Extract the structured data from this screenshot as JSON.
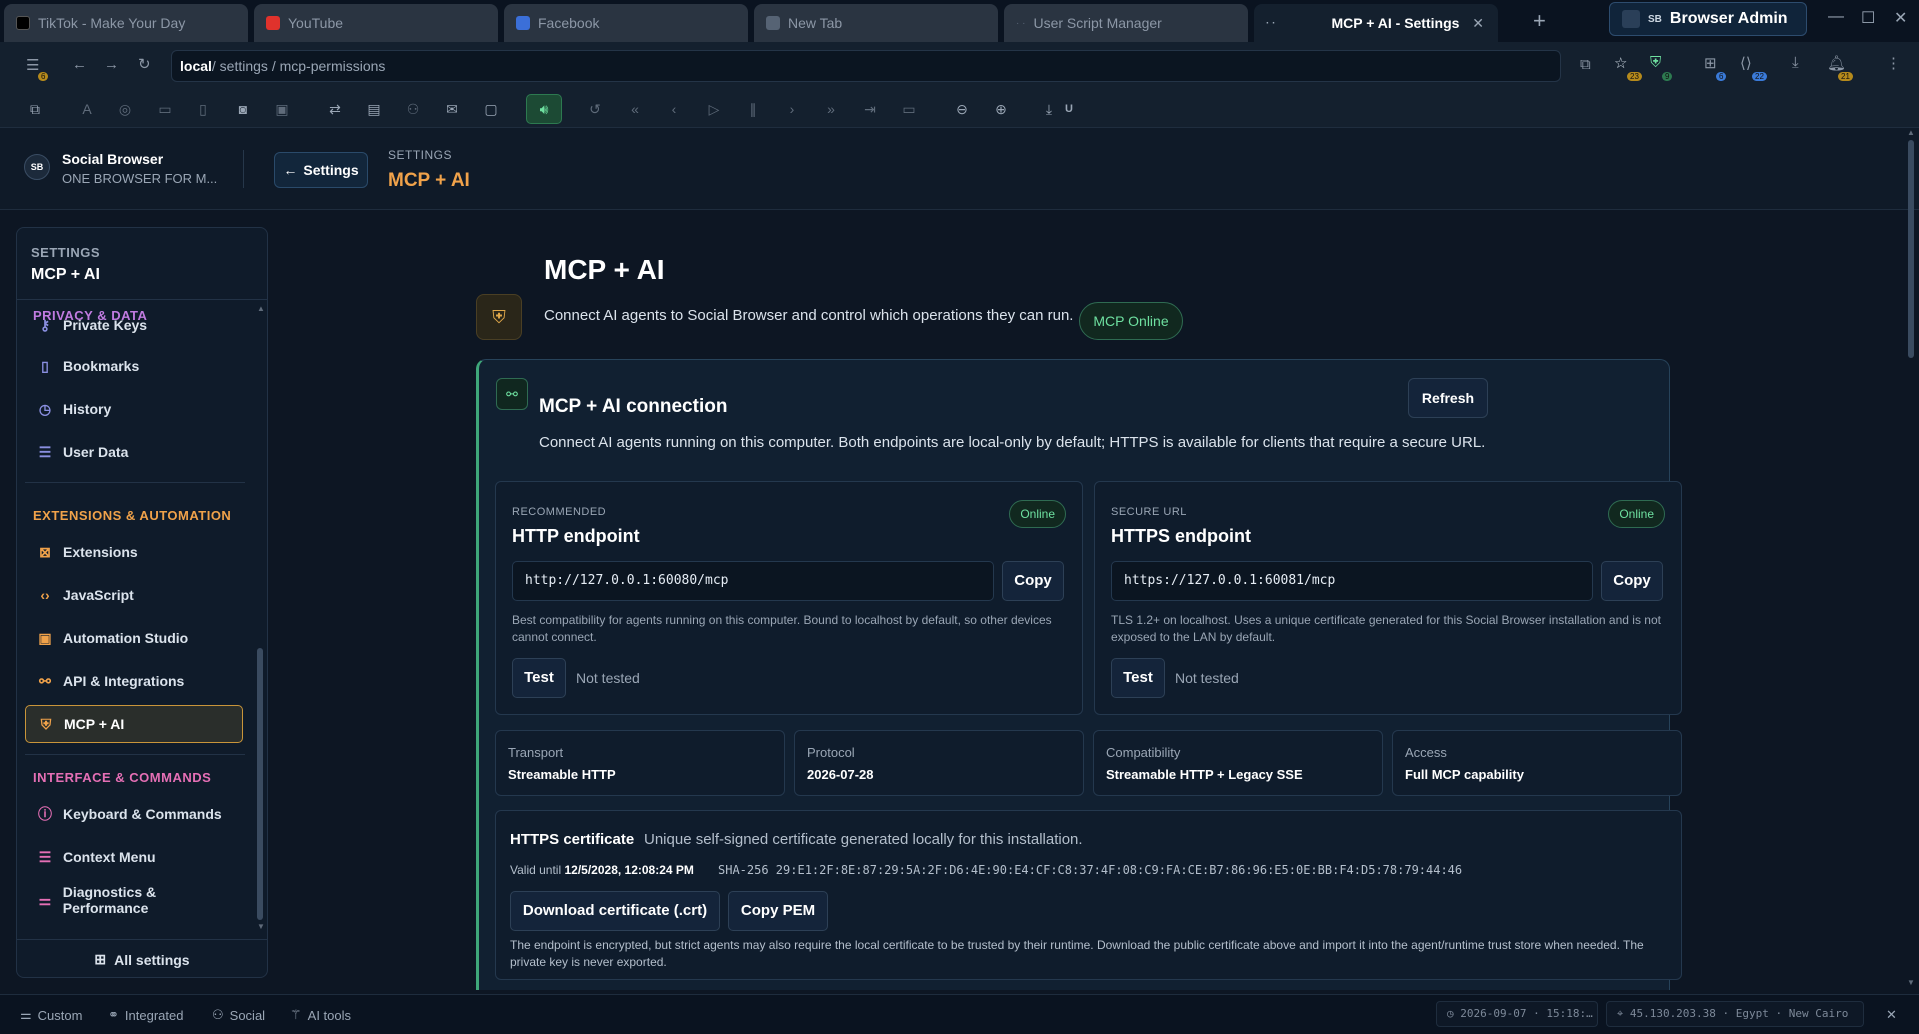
{
  "tabs": [
    {
      "label": "TikTok - Make Your Day",
      "icon": "tiktok-icon",
      "color": "#000000"
    },
    {
      "label": "YouTube",
      "icon": "youtube-icon",
      "color": "#e0322c"
    },
    {
      "label": "Facebook",
      "icon": "facebook-icon",
      "color": "#3b6fd8"
    },
    {
      "label": "New Tab",
      "icon": "shield-tab-icon",
      "color": "#566374"
    },
    {
      "label": "User Script Manager",
      "icon": "dots-tab-icon",
      "color": "#566374"
    },
    {
      "label": "MCP + AI - Settings",
      "icon": "dots-tab-icon",
      "color": "#566374",
      "active": true
    }
  ],
  "window": {
    "admin_prefix": "SB",
    "admin_label": "Browser Admin"
  },
  "address": {
    "host": "local",
    "path": " / settings / mcp-permissions"
  },
  "addr_badges": {
    "sidebar": "6",
    "star": "23",
    "shield": "9",
    "extensions": "6",
    "code": "22",
    "bell": "21"
  },
  "toolbar": {
    "download_label": "U"
  },
  "app": {
    "name": "Social Browser",
    "tagline": "ONE BROWSER FOR M...",
    "back_label": "Settings",
    "crumb_section": "SETTINGS",
    "crumb_page": "MCP + AI"
  },
  "sidebar": {
    "section_label": "SETTINGS",
    "title": "MCP + AI",
    "groups": [
      {
        "label": "PRIVACY & DATA",
        "color": "#c07be0"
      },
      {
        "label": "EXTENSIONS & AUTOMATION",
        "color": "#f0a24a"
      },
      {
        "label": "INTERFACE & COMMANDS",
        "color": "#e56fb5"
      }
    ],
    "items": [
      {
        "label": "Private Keys",
        "icon": "key-icon"
      },
      {
        "label": "Bookmarks",
        "icon": "bookmark-icon"
      },
      {
        "label": "History",
        "icon": "clock-icon"
      },
      {
        "label": "User Data",
        "icon": "database-icon"
      },
      {
        "label": "Extensions",
        "icon": "puzzle-icon"
      },
      {
        "label": "JavaScript",
        "icon": "code-icon"
      },
      {
        "label": "Automation Studio",
        "icon": "terminal-icon"
      },
      {
        "label": "API & Integrations",
        "icon": "network-icon"
      },
      {
        "label": "MCP + AI",
        "icon": "shield-icon",
        "active": true
      },
      {
        "label": "Keyboard & Commands",
        "icon": "info-icon"
      },
      {
        "label": "Context Menu",
        "icon": "menu-icon"
      },
      {
        "label": "Diagnostics & Performance",
        "icon": "sliders-icon"
      }
    ],
    "all_settings": "All settings"
  },
  "page": {
    "title": "MCP + AI",
    "description": "Connect AI agents to Social Browser and control which operations they can run.",
    "status_pill": "MCP Online"
  },
  "connection": {
    "title": "MCP + AI connection",
    "description": "Connect AI agents running on this computer. Both endpoints are local-only by default; HTTPS is available for clients that require a secure URL.",
    "refresh_label": "Refresh",
    "endpoints": [
      {
        "kicker": "RECOMMENDED",
        "title": "HTTP endpoint",
        "status": "Online",
        "url": "http://127.0.0.1:60080/mcp",
        "copy_label": "Copy",
        "note": "Best compatibility for agents running on this computer. Bound to localhost by default, so other devices cannot connect.",
        "test_label": "Test",
        "test_status": "Not tested"
      },
      {
        "kicker": "SECURE URL",
        "title": "HTTPS endpoint",
        "status": "Online",
        "url": "https://127.0.0.1:60081/mcp",
        "copy_label": "Copy",
        "note": "TLS 1.2+ on localhost. Uses a unique certificate generated for this Social Browser installation and is not exposed to the LAN by default.",
        "test_label": "Test",
        "test_status": "Not tested"
      }
    ],
    "meta": [
      {
        "key": "Transport",
        "value": "Streamable HTTP"
      },
      {
        "key": "Protocol",
        "value": "2026-07-28"
      },
      {
        "key": "Compatibility",
        "value": "Streamable HTTP + Legacy SSE"
      },
      {
        "key": "Access",
        "value": "Full MCP capability"
      }
    ],
    "certificate": {
      "title": "HTTPS certificate",
      "description": "Unique self-signed certificate generated locally for this installation.",
      "valid_prefix": "Valid until",
      "valid_until": "12/5/2028, 12:08:24 PM",
      "sha": "SHA-256 29:E1:2F:8E:87:29:5A:2F:D6:4E:90:E4:CF:C8:37:4F:08:C9:FA:CE:B7:86:96:E5:0E:BB:F4:D5:78:79:44:46",
      "download_label": "Download certificate (.crt)",
      "copy_pem_label": "Copy PEM",
      "note": "The endpoint is encrypted, but strict agents may also require the local certificate to be trusted by their runtime. Download the public certificate above and import it into the agent/runtime trust store when needed. The private key is never exported."
    }
  },
  "statusbar": {
    "items": [
      {
        "label": "Custom",
        "icon": "sliders-small-icon"
      },
      {
        "label": "Integrated",
        "icon": "link-icon"
      },
      {
        "label": "Social",
        "icon": "people-icon"
      },
      {
        "label": "AI tools",
        "icon": "ai-icon"
      }
    ],
    "datetime": "2026-09-07 · 15:18:…",
    "location": "45.130.203.38 · Egypt · New Cairo"
  }
}
